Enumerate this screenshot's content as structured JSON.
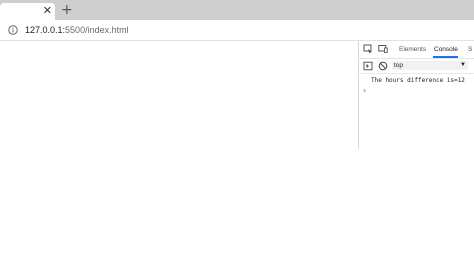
{
  "browser": {
    "tab": {
      "close_glyph": "✕",
      "close_icon": "close-icon"
    },
    "new_tab_glyph": "+",
    "address": {
      "info_icon": "info-icon",
      "url_host": "127.0.0.1:",
      "url_rest": "5500/index.html"
    }
  },
  "devtools": {
    "tabs": [
      {
        "label": "Elements",
        "active": false
      },
      {
        "label": "Console",
        "active": true
      },
      {
        "label": "S",
        "active": false
      }
    ],
    "toolbar": {
      "context": "top"
    },
    "console": {
      "messages": [
        "The hours difference is=12"
      ],
      "prompt": "›"
    }
  },
  "colors": {
    "accent": "#1a73e8",
    "tabstrip": "#cfcfcf"
  }
}
